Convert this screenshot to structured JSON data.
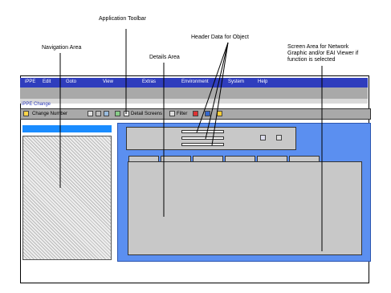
{
  "callouts": {
    "application_toolbar": "Application Toolbar",
    "header_data": "Header Data for Object",
    "navigation_area": "Navigation Area",
    "details_area": "Details Area",
    "screen_area": "Screen Area for Network\nGraphic and/or EAI Viewer if\nfunction is selected"
  },
  "menubar": {
    "items": [
      "iPPE",
      "Edit",
      "Goto",
      "View",
      "Extras",
      "Environment",
      "System",
      "Help"
    ]
  },
  "window": {
    "title": "iPPE Change"
  },
  "toolbar": {
    "change_number": "Change Number",
    "detail_screens": "Detail Screens",
    "filter": "Filter"
  },
  "colors": {
    "menubar": "#2f3dbd",
    "screen_area": "#5b8ff0",
    "nav_header": "#1a8cff",
    "panel_gray": "#c8c8c8"
  }
}
